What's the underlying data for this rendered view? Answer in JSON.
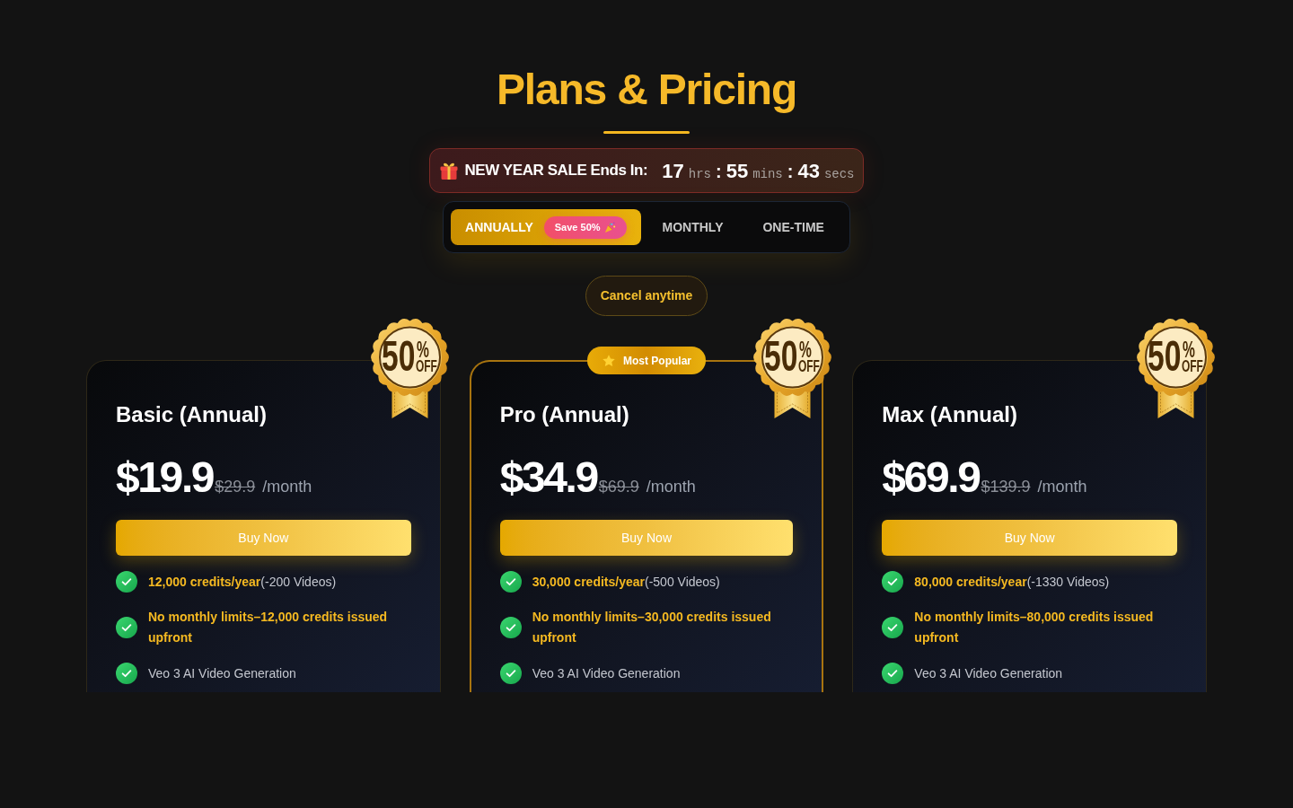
{
  "header": {
    "title": "Plans & Pricing"
  },
  "sale_banner": {
    "label": "NEW YEAR SALE Ends In:",
    "countdown": [
      {
        "value": "17",
        "unit": "hrs",
        "separator": ":"
      },
      {
        "value": "55",
        "unit": "mins",
        "separator": ":"
      },
      {
        "value": "43",
        "unit": "secs"
      }
    ]
  },
  "billing_tabs": [
    {
      "label": "ANNUALLY",
      "selected": true,
      "tag": "Save 50%"
    },
    {
      "label": "MONTHLY",
      "selected": false
    },
    {
      "label": "ONE-TIME",
      "selected": false
    }
  ],
  "note": "Cancel anytime",
  "plans": [
    {
      "title": "Basic (Annual)",
      "price": "$19.9",
      "original_price": "$29.9",
      "period": "/month",
      "button": "Buy Now",
      "featured": false,
      "discount": {
        "value": "50",
        "symbol": "%",
        "label": "OFF"
      },
      "features": [
        {
          "kind": "plain",
          "text": "**12,000 credits/year**(-200 Videos)"
        },
        {
          "kind": "highlight",
          "text": "No monthly limits–12,000 credits issued upfront"
        },
        {
          "kind": "plain",
          "text": "Veo 3 AI Video Generation"
        }
      ]
    },
    {
      "title": "Pro (Annual)",
      "price": "$34.9",
      "original_price": "$69.9",
      "period": "/month",
      "button": "Buy Now",
      "featured": true,
      "ribbon": "Most Popular",
      "discount": {
        "value": "50",
        "symbol": "%",
        "label": "OFF"
      },
      "features": [
        {
          "kind": "plain",
          "text": "**30,000 credits/year**(-500 Videos)"
        },
        {
          "kind": "highlight",
          "text": "No monthly limits–30,000 credits issued upfront"
        },
        {
          "kind": "plain",
          "text": "Veo 3 AI Video Generation"
        }
      ]
    },
    {
      "title": "Max (Annual)",
      "price": "$69.9",
      "original_price": "$139.9",
      "period": "/month",
      "button": "Buy Now",
      "featured": false,
      "discount": {
        "value": "50",
        "symbol": "%",
        "label": "OFF"
      },
      "features": [
        {
          "kind": "plain",
          "text": "**80,000 credits/year**(-1330 Videos)"
        },
        {
          "kind": "highlight",
          "text": "No monthly limits–80,000 credits issued upfront"
        },
        {
          "kind": "plain",
          "text": "Veo 3 AI Video Generation"
        }
      ]
    }
  ]
}
